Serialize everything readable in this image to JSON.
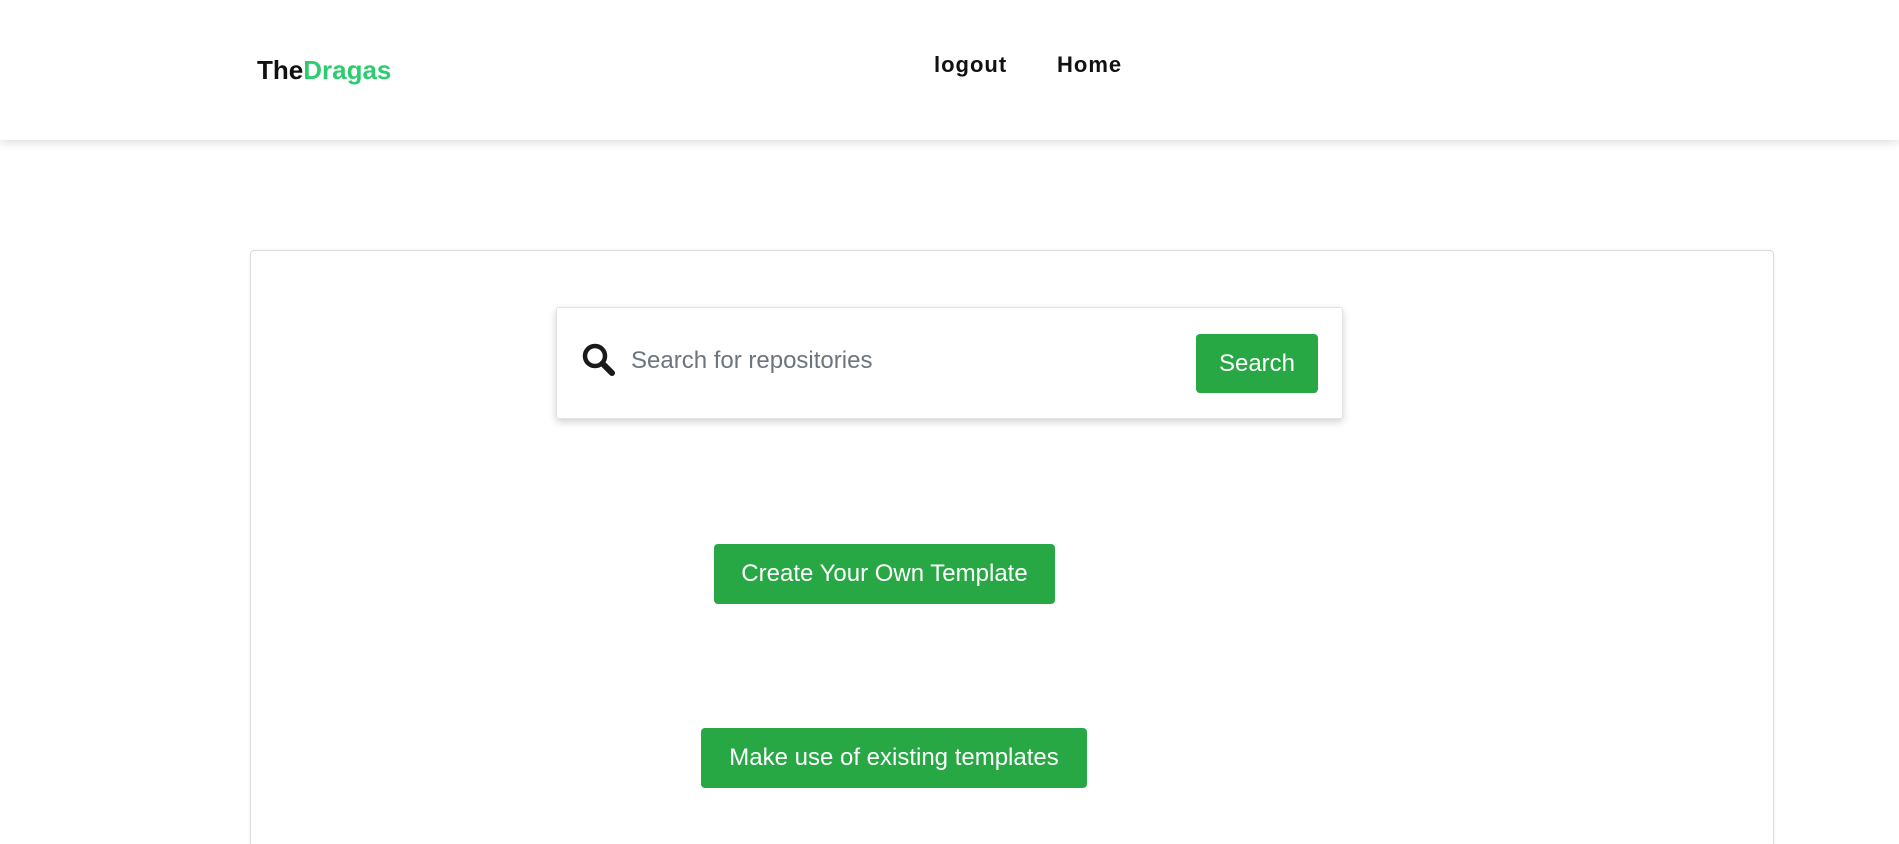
{
  "navbar": {
    "brand_prefix": "The",
    "brand_accent": "Dragas",
    "links": [
      "logout",
      "Home"
    ]
  },
  "search": {
    "placeholder": "Search for repositories",
    "value": "",
    "button_label": "Search",
    "icon": "search-icon"
  },
  "actions": {
    "create_label": "Create Your Own Template",
    "existing_label": "Make use of existing templates"
  },
  "colors": {
    "accent": "#2ecc71",
    "button": "#28a745",
    "text": "#111111"
  }
}
